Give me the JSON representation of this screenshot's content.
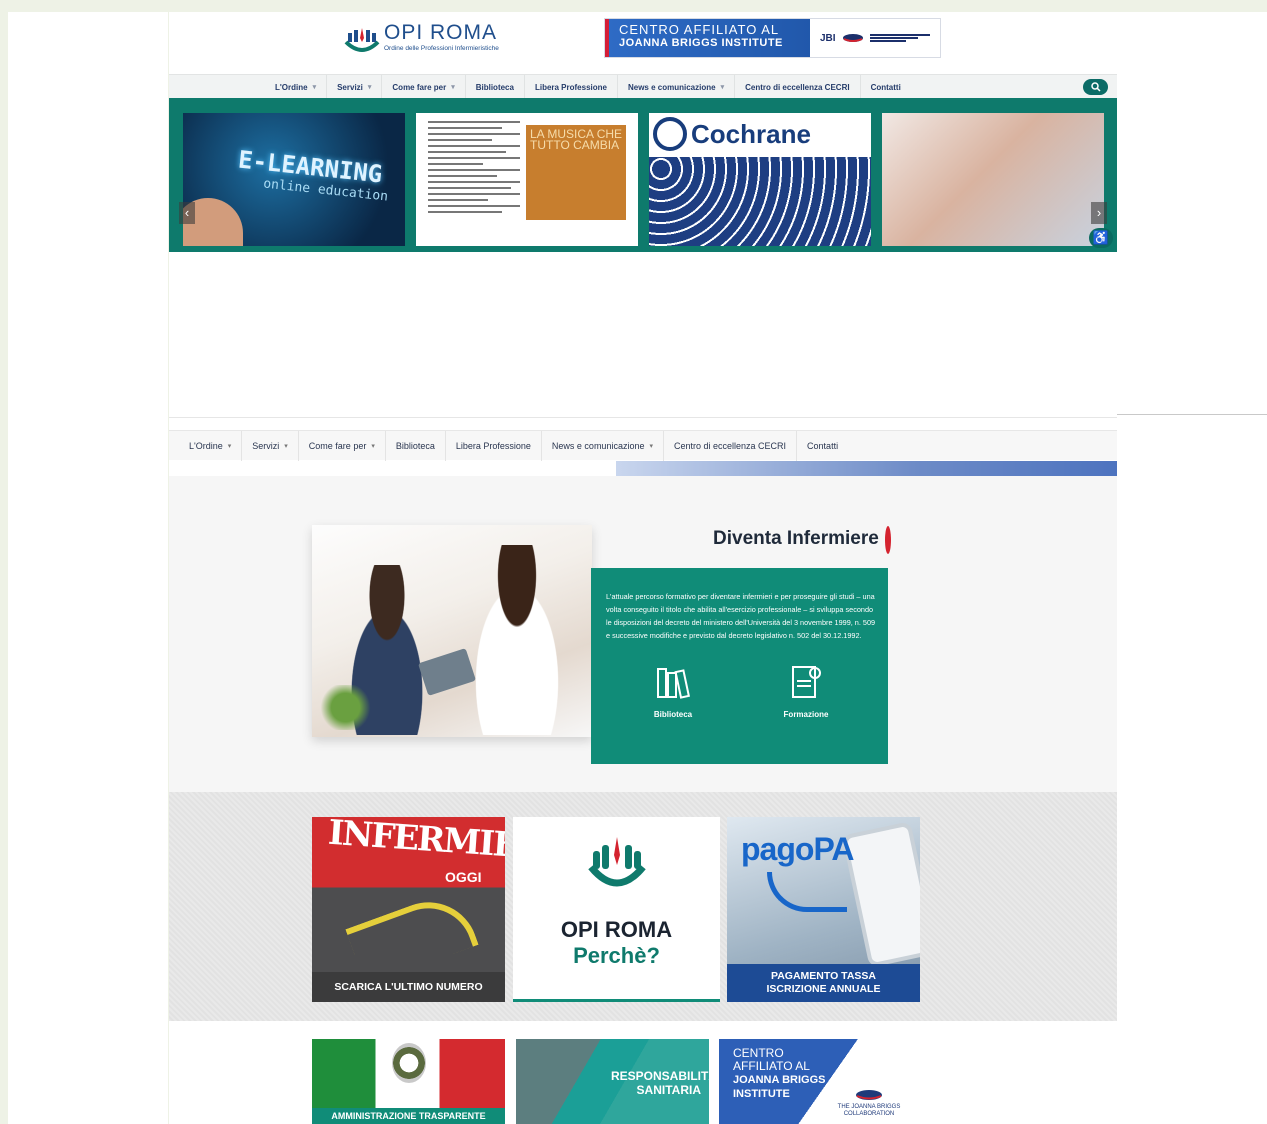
{
  "header": {
    "logo_name": "OPI ROMA",
    "logo_sub": "Ordine delle Professioni Infermieristiche",
    "jbi_banner": {
      "line1": "CENTRO AFFILIATO AL",
      "line2": "JOANNA BRIGGS INSTITUTE",
      "mark": "JBI"
    }
  },
  "nav": {
    "items": [
      {
        "label": "L'Ordine",
        "dropdown": true
      },
      {
        "label": "Servizi",
        "dropdown": true
      },
      {
        "label": "Come fare per",
        "dropdown": true
      },
      {
        "label": "Biblioteca",
        "dropdown": false
      },
      {
        "label": "Libera Professione",
        "dropdown": false
      },
      {
        "label": "News e comunicazione",
        "dropdown": true
      },
      {
        "label": "Centro di eccellenza CECRI",
        "dropdown": false
      },
      {
        "label": "Contatti",
        "dropdown": false
      }
    ],
    "caret": "▾"
  },
  "slider": {
    "slide1_title": "E-LEARNING",
    "slide1_sub": "online education",
    "slide2_title": "LA MUSICA CHE TUTTO CAMBIA",
    "slide3_title": "Cochrane",
    "prev": "‹",
    "next": "›",
    "accessibility_icon": "wheelchair-icon",
    "accessibility_glyph": "♿"
  },
  "diventa": {
    "title": "Diventa Infermiere",
    "text": "L'attuale percorso formativo per diventare infermieri e per proseguire gli studi – una volta conseguito il titolo che abilita all'esercizio professionale – si sviluppa secondo le disposizioni del decreto del ministero dell'Università del 3 novembre 1999, n. 509 e successive modifiche e previsto dal decreto legislativo n. 502 del 30.12.1992.",
    "links": [
      "Biblioteca",
      "Formazione"
    ]
  },
  "tiles": {
    "infermiere": {
      "title": "INFERMIERE",
      "sub": "OGGI",
      "caption": "SCARICA L'ULTIMO NUMERO"
    },
    "opi": {
      "line1": "OPI ROMA",
      "line2": "Perchè?"
    },
    "pagopa": {
      "brand": "pagoPA",
      "caption_l1": "PAGAMENTO TASSA",
      "caption_l2": "ISCRIZIONE ANNUALE"
    }
  },
  "bottom_tiles": {
    "amministrazione": "AMMINISTRAZIONE TRASPARENTE",
    "responsabilita_l1": "RESPONSABILITÀ",
    "responsabilita_l2": "SANITARIA",
    "jbi_l1": "CENTRO",
    "jbi_l2": "AFFILIATO AL",
    "jbi_l3": "JOANNA BRIGGS",
    "jbi_l4": "INSTITUTE",
    "jbi_collab": "THE JOANNA BRIGGS COLLABORATION"
  },
  "colors": {
    "brand_green": "#108c78",
    "nav_text": "#253c6a",
    "accent_red": "#d4232f"
  }
}
